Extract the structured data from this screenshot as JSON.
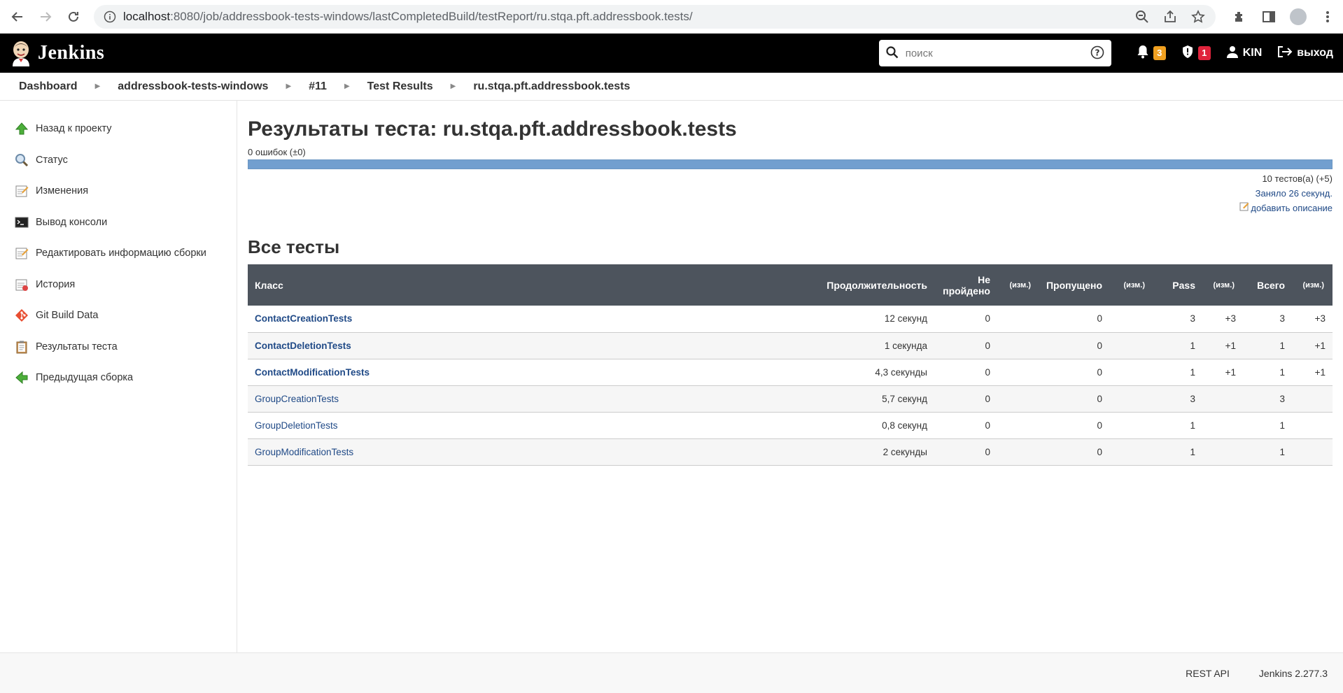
{
  "browser": {
    "url_host": "localhost",
    "url_path": ":8080/job/addressbook-tests-windows/lastCompletedBuild/testReport/ru.stqa.pft.addressbook.tests/"
  },
  "header": {
    "brand": "Jenkins",
    "search_placeholder": "поиск",
    "notifications_count": "3",
    "security_count": "1",
    "user": "KIN",
    "logout": "выход"
  },
  "breadcrumb": [
    "Dashboard",
    "addressbook-tests-windows",
    "#11",
    "Test Results",
    "ru.stqa.pft.addressbook.tests"
  ],
  "sidebar": {
    "items": [
      {
        "label": "Назад к проекту",
        "icon": "up-arrow-icon"
      },
      {
        "label": "Статус",
        "icon": "magnifier-icon"
      },
      {
        "label": "Изменения",
        "icon": "notepad-icon"
      },
      {
        "label": "Вывод консоли",
        "icon": "terminal-icon"
      },
      {
        "label": "Редактировать информацию сборки",
        "icon": "notepad-icon"
      },
      {
        "label": "История",
        "icon": "notepad-icon"
      },
      {
        "label": "Git Build Data",
        "icon": "git-icon"
      },
      {
        "label": "Результаты теста",
        "icon": "clipboard-icon"
      },
      {
        "label": "Предыдущая сборка",
        "icon": "left-arrow-icon"
      }
    ]
  },
  "content": {
    "title": "Результаты теста: ru.stqa.pft.addressbook.tests",
    "failures": "0 ошибок (±0)",
    "tests_count": "10 тестов(а) (+5)",
    "duration": "Заняло 26 секунд.",
    "add_description": "добавить описание",
    "all_tests_heading": "Все тесты"
  },
  "table": {
    "headers": {
      "class": "Класс",
      "duration": "Продолжительность",
      "failed_line1": "Не",
      "failed_line2": "пройдено",
      "diff": "(изм.)",
      "skipped": "Пропущено",
      "pass": "Pass",
      "total": "Всего"
    },
    "rows": [
      {
        "name": "ContactCreationTests",
        "bold": true,
        "duration": "12 секунд",
        "failed": "0",
        "failed_diff": "",
        "skipped": "0",
        "skipped_diff": "",
        "pass": "3",
        "pass_diff": "+3",
        "total": "3",
        "total_diff": "+3"
      },
      {
        "name": "ContactDeletionTests",
        "bold": true,
        "duration": "1 секунда",
        "failed": "0",
        "failed_diff": "",
        "skipped": "0",
        "skipped_diff": "",
        "pass": "1",
        "pass_diff": "+1",
        "total": "1",
        "total_diff": "+1"
      },
      {
        "name": "ContactModificationTests",
        "bold": true,
        "duration": "4,3 секунды",
        "failed": "0",
        "failed_diff": "",
        "skipped": "0",
        "skipped_diff": "",
        "pass": "1",
        "pass_diff": "+1",
        "total": "1",
        "total_diff": "+1"
      },
      {
        "name": "GroupCreationTests",
        "bold": false,
        "duration": "5,7 секунд",
        "failed": "0",
        "failed_diff": "",
        "skipped": "0",
        "skipped_diff": "",
        "pass": "3",
        "pass_diff": "",
        "total": "3",
        "total_diff": ""
      },
      {
        "name": "GroupDeletionTests",
        "bold": false,
        "duration": "0,8 секунд",
        "failed": "0",
        "failed_diff": "",
        "skipped": "0",
        "skipped_diff": "",
        "pass": "1",
        "pass_diff": "",
        "total": "1",
        "total_diff": ""
      },
      {
        "name": "GroupModificationTests",
        "bold": false,
        "duration": "2 секунды",
        "failed": "0",
        "failed_diff": "",
        "skipped": "0",
        "skipped_diff": "",
        "pass": "1",
        "pass_diff": "",
        "total": "1",
        "total_diff": ""
      }
    ]
  },
  "footer": {
    "rest_api": "REST API",
    "version": "Jenkins 2.277.3"
  }
}
